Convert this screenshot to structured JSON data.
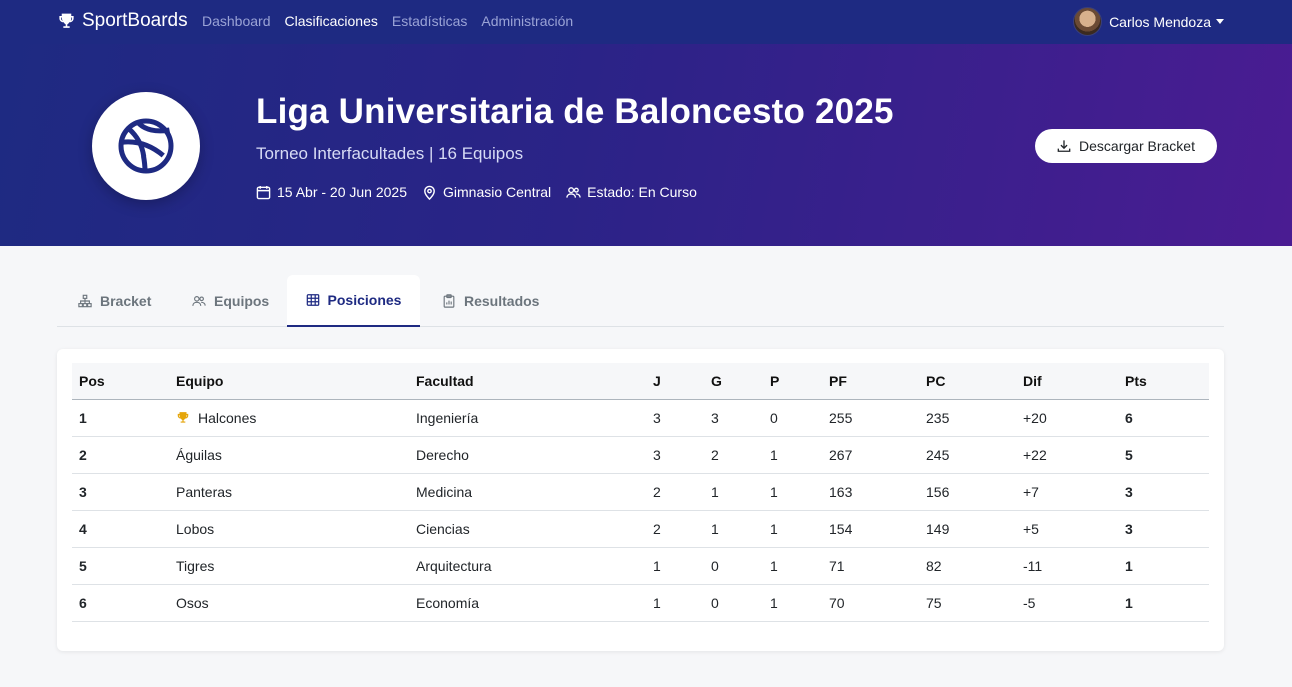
{
  "navbar": {
    "brand": "SportBoards",
    "links": [
      "Dashboard",
      "Clasificaciones",
      "Estadísticas",
      "Administración"
    ],
    "active_link": "Clasificaciones",
    "user_name": "Carlos Mendoza"
  },
  "hero": {
    "title": "Liga Universitaria de Baloncesto 2025",
    "subtitle": "Torneo Interfacultades | 16 Equipos",
    "dates": "15 Abr - 20 Jun 2025",
    "venue": "Gimnasio Central",
    "status": "Estado: En Curso",
    "download_label": "Descargar Bracket"
  },
  "tabs": [
    {
      "label": "Bracket",
      "icon": "sitemap-icon"
    },
    {
      "label": "Equipos",
      "icon": "people-icon"
    },
    {
      "label": "Posiciones",
      "icon": "table-icon",
      "active": true
    },
    {
      "label": "Resultados",
      "icon": "clipboard-icon"
    }
  ],
  "standings": {
    "headers": [
      "Pos",
      "Equipo",
      "Facultad",
      "J",
      "G",
      "P",
      "PF",
      "PC",
      "Dif",
      "Pts"
    ],
    "rows": [
      {
        "pos": "1",
        "team": "Halcones",
        "faculty": "Ingeniería",
        "j": "3",
        "g": "3",
        "p": "0",
        "pf": "255",
        "pc": "235",
        "dif": "+20",
        "pts": "6",
        "leader": true
      },
      {
        "pos": "2",
        "team": "Águilas",
        "faculty": "Derecho",
        "j": "3",
        "g": "2",
        "p": "1",
        "pf": "267",
        "pc": "245",
        "dif": "+22",
        "pts": "5"
      },
      {
        "pos": "3",
        "team": "Panteras",
        "faculty": "Medicina",
        "j": "2",
        "g": "1",
        "p": "1",
        "pf": "163",
        "pc": "156",
        "dif": "+7",
        "pts": "3"
      },
      {
        "pos": "4",
        "team": "Lobos",
        "faculty": "Ciencias",
        "j": "2",
        "g": "1",
        "p": "1",
        "pf": "154",
        "pc": "149",
        "dif": "+5",
        "pts": "3"
      },
      {
        "pos": "5",
        "team": "Tigres",
        "faculty": "Arquitectura",
        "j": "1",
        "g": "0",
        "p": "1",
        "pf": "71",
        "pc": "82",
        "dif": "-11",
        "pts": "1"
      },
      {
        "pos": "6",
        "team": "Osos",
        "faculty": "Economía",
        "j": "1",
        "g": "0",
        "p": "1",
        "pf": "70",
        "pc": "75",
        "dif": "-5",
        "pts": "1"
      }
    ]
  },
  "colors": {
    "navbar": "#1e2a82",
    "hero_start": "#1e2a82",
    "hero_end": "#4a1c92",
    "accent": "#1e2a82",
    "trophy": "#e5a50a"
  }
}
